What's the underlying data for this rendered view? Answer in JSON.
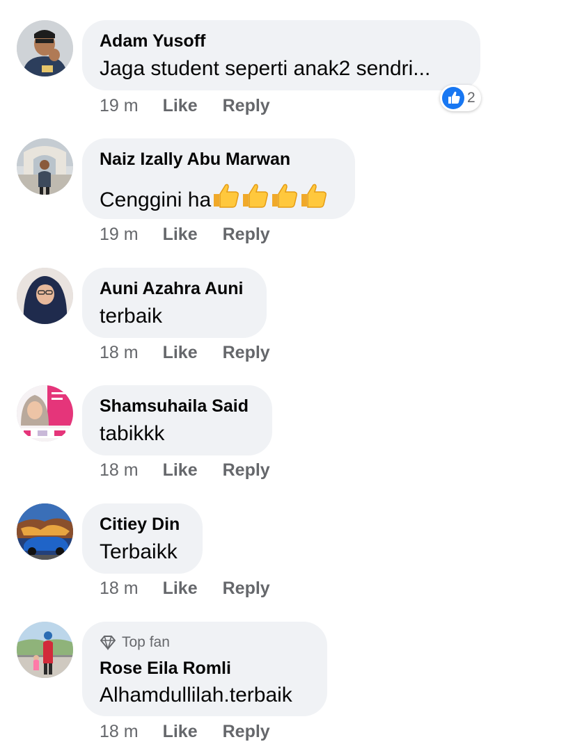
{
  "comments": [
    {
      "author": "Adam Yusoff",
      "text": "Jaga student seperti anak2 sendri...",
      "time": "19 m",
      "like": "Like",
      "reply": "Reply",
      "reaction_count": "2"
    },
    {
      "author": "Naiz Izally Abu Marwan",
      "text": "Cenggini ha",
      "text_emoji": "thumbs-up-x4",
      "time": "19 m",
      "like": "Like",
      "reply": "Reply"
    },
    {
      "author": "Auni Azahra Auni",
      "text": "terbaik",
      "time": "18 m",
      "like": "Like",
      "reply": "Reply"
    },
    {
      "author": "Shamsuhaila Said",
      "text": "tabikkk",
      "time": "18 m",
      "like": "Like",
      "reply": "Reply"
    },
    {
      "author": "Citiey Din",
      "text": "Terbaikk",
      "time": "18 m",
      "like": "Like",
      "reply": "Reply"
    },
    {
      "badge": "Top fan",
      "badge_icon": "diamond-icon",
      "author": "Rose Eila Romli",
      "text": "Alhamdullilah.terbaik",
      "time": "18 m",
      "like": "Like",
      "reply": "Reply"
    }
  ],
  "colors": {
    "bubble": "#f0f2f5",
    "meta_text": "#65676b",
    "primary_text": "#050505",
    "like_blue": "#1877f2",
    "thumbs_yellow": "#ffc83d"
  }
}
